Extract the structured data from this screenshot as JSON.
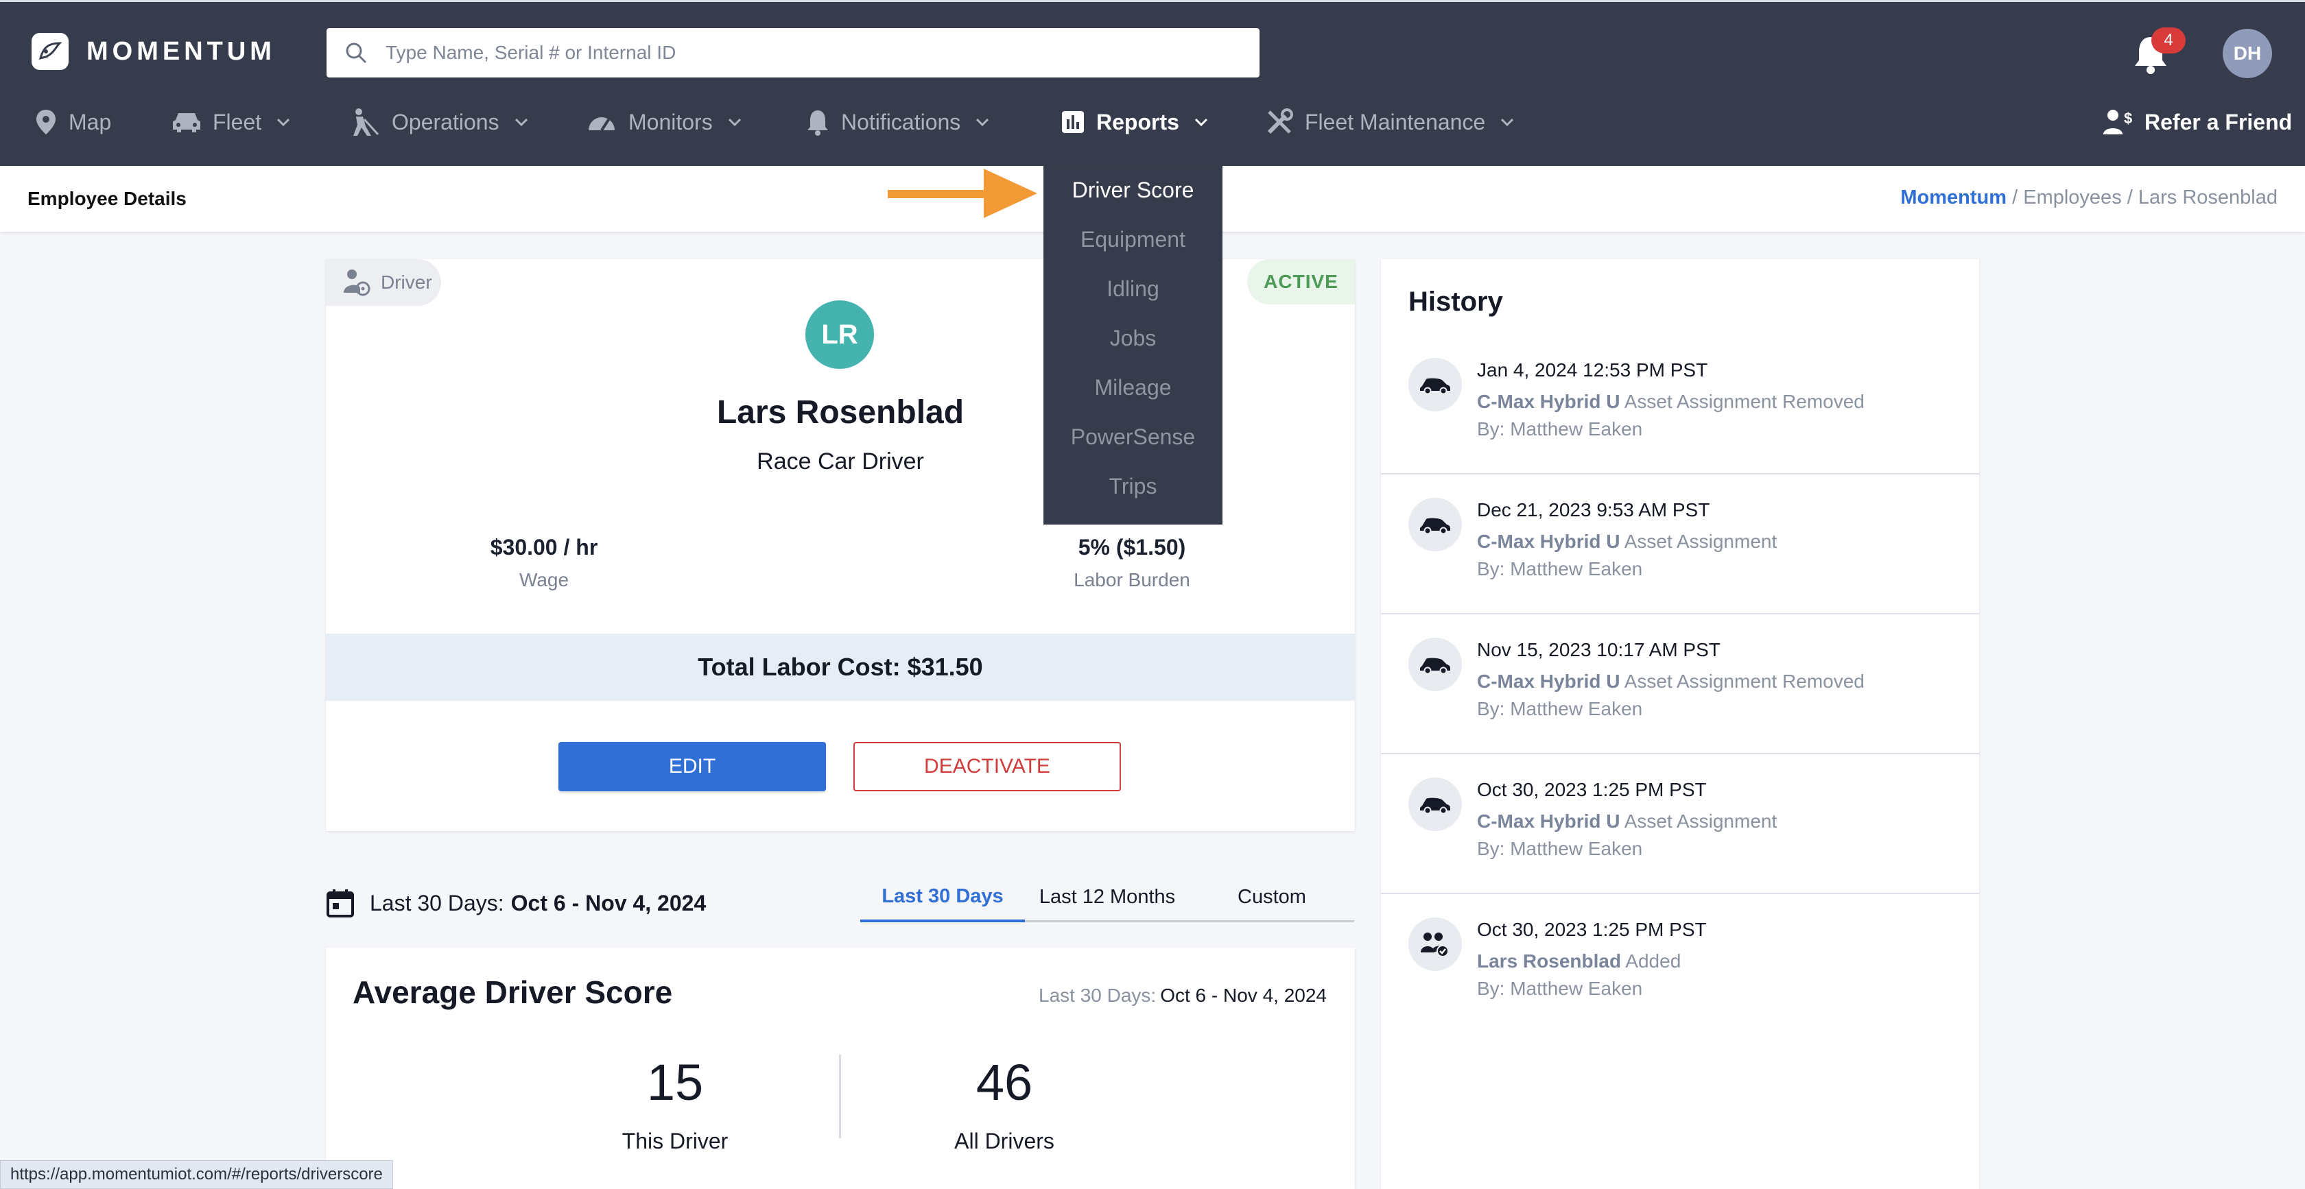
{
  "header": {
    "brand": "MOMENTUM",
    "search_placeholder": "Type Name, Serial # or Internal ID",
    "notification_count": "4",
    "user_initials": "DH",
    "refer_label": "Refer a Friend"
  },
  "nav": {
    "map": "Map",
    "fleet": "Fleet",
    "operations": "Operations",
    "monitors": "Monitors",
    "notifications": "Notifications",
    "reports": "Reports",
    "fleet_maintenance": "Fleet Maintenance"
  },
  "reports_menu": [
    "Driver Score",
    "Equipment",
    "Idling",
    "Jobs",
    "Mileage",
    "PowerSense",
    "Trips"
  ],
  "subheader": {
    "title": "Employee Details",
    "breadcrumb_home": "Momentum",
    "breadcrumb_rest": " / Employees / Lars Rosenblad"
  },
  "employee": {
    "role": "Driver",
    "status": "ACTIVE",
    "initials": "LR",
    "name": "Lars Rosenblad",
    "title": "Race Car Driver",
    "wage_value": "$30.00 / hr",
    "wage_label": "Wage",
    "burden_value": "5% ($1.50)",
    "burden_label": "Labor Burden",
    "total_labor_cost": "Total Labor Cost: $31.50",
    "edit_label": "EDIT",
    "deactivate_label": "DEACTIVATE"
  },
  "date_filter": {
    "label": "Last 30 Days:",
    "range": "Oct 6 - Nov 4, 2024",
    "tabs": [
      "Last 30 Days",
      "Last 12 Months",
      "Custom"
    ]
  },
  "driver_score": {
    "title": "Average Driver Score",
    "range_label": "Last 30 Days:",
    "range_value": "Oct 6 - Nov 4, 2024",
    "this_driver_value": "15",
    "this_driver_label": "This Driver",
    "all_drivers_value": "46",
    "all_drivers_label": "All Drivers"
  },
  "history": {
    "title": "History",
    "items": [
      {
        "time": "Jan 4, 2024 12:53 PM PST",
        "subject": "C-Max Hybrid U",
        "action": " Asset Assignment Removed",
        "by": "By: Matthew Eaken",
        "icon": "car-icon"
      },
      {
        "time": "Dec 21, 2023 9:53 AM PST",
        "subject": "C-Max Hybrid U",
        "action": " Asset Assignment",
        "by": "By: Matthew Eaken",
        "icon": "car-icon"
      },
      {
        "time": "Nov 15, 2023 10:17 AM PST",
        "subject": "C-Max Hybrid U",
        "action": " Asset Assignment Removed",
        "by": "By: Matthew Eaken",
        "icon": "car-icon"
      },
      {
        "time": "Oct 30, 2023 1:25 PM PST",
        "subject": "C-Max Hybrid U",
        "action": " Asset Assignment",
        "by": "By: Matthew Eaken",
        "icon": "car-icon"
      },
      {
        "time": "Oct 30, 2023 1:25 PM PST",
        "subject": "Lars Rosenblad",
        "action": " Added",
        "by": "By: Matthew Eaken",
        "icon": "people-added-icon"
      }
    ]
  },
  "status_url": "https://app.momentumiot.com/#/reports/driverscore"
}
